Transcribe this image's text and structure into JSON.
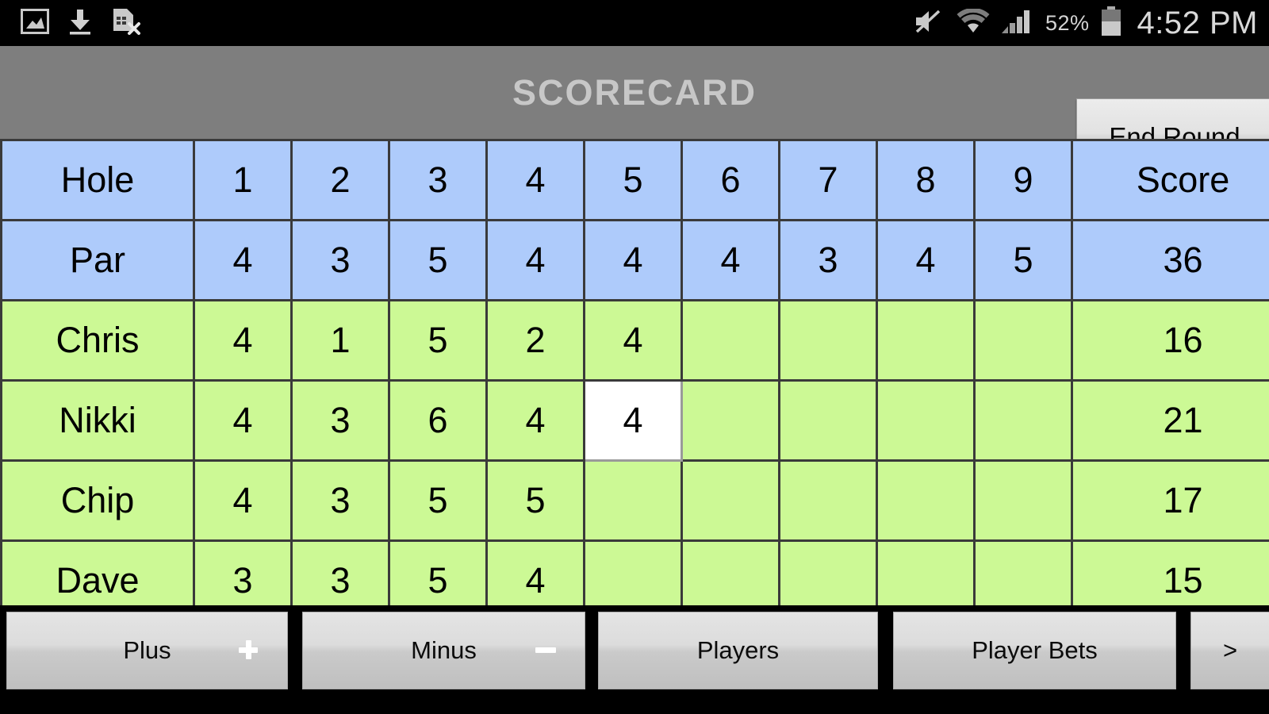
{
  "status_bar": {
    "left_icons": [
      "image-icon",
      "download-icon",
      "sim-card-error-icon"
    ],
    "right_icons": [
      "mute-icon",
      "wifi-icon",
      "cellular-signal-icon",
      "battery-icon"
    ],
    "battery_percent": "52%",
    "clock": "4:52 PM"
  },
  "action_bar": {
    "title": "SCORECARD",
    "end_round_label": "End Round"
  },
  "scorecard": {
    "columns": [
      "Hole",
      "1",
      "2",
      "3",
      "4",
      "5",
      "6",
      "7",
      "8",
      "9",
      "Score"
    ],
    "par_label": "Par",
    "par": [
      "4",
      "3",
      "5",
      "4",
      "4",
      "4",
      "3",
      "4",
      "5"
    ],
    "par_total": "36",
    "players": [
      {
        "name": "Chris",
        "holes": [
          "4",
          "1",
          "5",
          "2",
          "4",
          "",
          "",
          "",
          ""
        ],
        "total": "16"
      },
      {
        "name": "Nikki",
        "holes": [
          "4",
          "3",
          "6",
          "4",
          "4",
          "",
          "",
          "",
          ""
        ],
        "total": "21"
      },
      {
        "name": "Chip",
        "holes": [
          "4",
          "3",
          "5",
          "5",
          "",
          "",
          "",
          "",
          ""
        ],
        "total": "17"
      },
      {
        "name": "Dave",
        "holes": [
          "3",
          "3",
          "5",
          "4",
          "",
          "",
          "",
          "",
          ""
        ],
        "total": "15"
      }
    ],
    "selected_cell": {
      "player_index": 1,
      "hole_index": 4
    },
    "colors": {
      "header_cell": "#aecbfb",
      "player_cell": "#ccf995",
      "selected_cell": "#ffffff",
      "grid_line": "#3a3a3a"
    }
  },
  "button_bar": {
    "plus": "Plus",
    "minus": "Minus",
    "players": "Players",
    "player_bets": "Player Bets",
    "more": ">"
  }
}
